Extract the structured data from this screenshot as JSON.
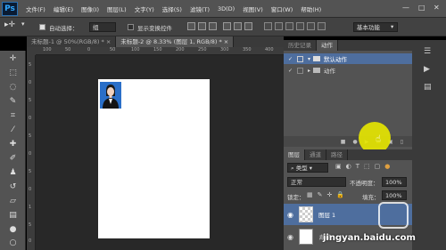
{
  "app": {
    "logo": "Ps"
  },
  "menu": [
    "文件(F)",
    "编辑(E)",
    "图像(I)",
    "图层(L)",
    "文字(Y)",
    "选择(S)",
    "滤镜(T)",
    "3D(D)",
    "视图(V)",
    "窗口(W)",
    "帮助(H)"
  ],
  "window_controls": {
    "minimize": "—",
    "restore": "□",
    "close": "✕"
  },
  "options": {
    "auto_select_label": "自动选择：",
    "auto_select_value": "组",
    "show_transform_label": "显示变换控件",
    "workspace": "基本功能"
  },
  "tabs": [
    {
      "label": "未标题-1 @ 50%(RGB/8) *",
      "close": "×"
    },
    {
      "label": "未标题-2 @ 8.33% (图层 1, RGB/8) *",
      "close": "×"
    }
  ],
  "ruler": {
    "h": [
      "100",
      "50",
      "0",
      "50",
      "100",
      "150",
      "200",
      "250",
      "300",
      "350",
      "400"
    ],
    "v": [
      "5",
      "0",
      "5",
      "0",
      "5",
      "0",
      "5",
      "0",
      "1",
      "5",
      "0"
    ]
  },
  "actions_panel": {
    "tabs": [
      "历史记录",
      "动作"
    ],
    "items": [
      {
        "name": "默认动作",
        "selected": true
      },
      {
        "name": "动作",
        "selected": false
      }
    ]
  },
  "layers_panel": {
    "tabs": [
      "图层",
      "通道",
      "路径"
    ],
    "kind_filter": "类型",
    "blend_mode": "正常",
    "opacity_label": "不透明度：",
    "opacity": "100%",
    "lock_label": "锁定：",
    "fill_label": "填充：",
    "fill": "100%",
    "layers": [
      {
        "name": "图层 1",
        "selected": true
      },
      {
        "name": "背景",
        "selected": false
      }
    ]
  },
  "watermark": "jingyan.baidu.com",
  "colors": {
    "highlight": "#e8e800",
    "selection": "#4e6e9e"
  }
}
